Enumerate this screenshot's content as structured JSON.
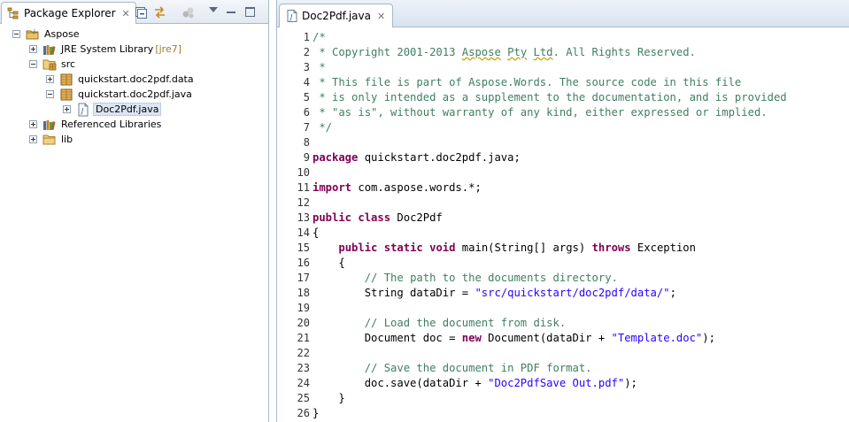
{
  "left_view": {
    "tab_label": "Package Explorer",
    "tree": [
      {
        "label": "Aspose",
        "decoration": "",
        "icon": "project-icon",
        "indent": 0,
        "expanded": true
      },
      {
        "label": "JRE System Library",
        "decoration": "[jre7]",
        "icon": "library-icon",
        "indent": 1,
        "expanded": false
      },
      {
        "label": "src",
        "decoration": "",
        "icon": "source-folder-icon",
        "indent": 1,
        "expanded": true
      },
      {
        "label": "quickstart.doc2pdf.data",
        "decoration": "",
        "icon": "package-icon",
        "indent": 2,
        "expanded": false
      },
      {
        "label": "quickstart.doc2pdf.java",
        "decoration": "",
        "icon": "package-icon",
        "indent": 2,
        "expanded": true
      },
      {
        "label": "Doc2Pdf.java",
        "decoration": "",
        "icon": "java-file-icon",
        "indent": 3,
        "expanded": false,
        "selected": true
      },
      {
        "label": "Referenced Libraries",
        "decoration": "",
        "icon": "library-icon",
        "indent": 1,
        "expanded": false
      },
      {
        "label": "lib",
        "decoration": "",
        "icon": "folder-icon",
        "indent": 1,
        "expanded": false
      }
    ]
  },
  "editor": {
    "tab_label": "Doc2Pdf.java",
    "lines": [
      {
        "n": "1",
        "parts": [
          {
            "t": "/*",
            "c": "cm"
          }
        ]
      },
      {
        "n": "2",
        "parts": [
          {
            "t": " * Copyright 2001-2013 ",
            "c": "cm"
          },
          {
            "t": "Aspose",
            "c": "cm sq"
          },
          {
            "t": " ",
            "c": "cm"
          },
          {
            "t": "Pty",
            "c": "cm sq"
          },
          {
            "t": " ",
            "c": "cm"
          },
          {
            "t": "Ltd",
            "c": "cm sq"
          },
          {
            "t": ". All Rights Reserved.",
            "c": "cm"
          }
        ]
      },
      {
        "n": "3",
        "parts": [
          {
            "t": " *",
            "c": "cm"
          }
        ]
      },
      {
        "n": "4",
        "parts": [
          {
            "t": " * This file is part of Aspose.Words. The source code in this file",
            "c": "cm"
          }
        ]
      },
      {
        "n": "5",
        "parts": [
          {
            "t": " * is only intended as a supplement to the documentation, and is provided",
            "c": "cm"
          }
        ]
      },
      {
        "n": "6",
        "parts": [
          {
            "t": " * \"as is\", without warranty of any kind, either expressed or implied.",
            "c": "cm"
          }
        ]
      },
      {
        "n": "7",
        "parts": [
          {
            "t": " */",
            "c": "cm"
          }
        ]
      },
      {
        "n": "8",
        "parts": []
      },
      {
        "n": "9",
        "parts": [
          {
            "t": "package",
            "c": "kw"
          },
          {
            "t": " quickstart.doc2pdf.java;",
            "c": "pl"
          }
        ]
      },
      {
        "n": "10",
        "parts": []
      },
      {
        "n": "11",
        "parts": [
          {
            "t": "import",
            "c": "kw"
          },
          {
            "t": " com.aspose.words.*;",
            "c": "pl"
          }
        ]
      },
      {
        "n": "12",
        "parts": []
      },
      {
        "n": "13",
        "parts": [
          {
            "t": "public",
            "c": "kw"
          },
          {
            "t": " ",
            "c": "pl"
          },
          {
            "t": "class",
            "c": "kw"
          },
          {
            "t": " Doc2Pdf",
            "c": "pl"
          }
        ]
      },
      {
        "n": "14",
        "parts": [
          {
            "t": "{",
            "c": "pl"
          }
        ]
      },
      {
        "n": "15",
        "parts": [
          {
            "t": "    ",
            "c": "pl"
          },
          {
            "t": "public",
            "c": "kw"
          },
          {
            "t": " ",
            "c": "pl"
          },
          {
            "t": "static",
            "c": "kw"
          },
          {
            "t": " ",
            "c": "pl"
          },
          {
            "t": "void",
            "c": "kw"
          },
          {
            "t": " main(String[] args) ",
            "c": "pl"
          },
          {
            "t": "throws",
            "c": "kw"
          },
          {
            "t": " Exception",
            "c": "pl"
          }
        ]
      },
      {
        "n": "16",
        "parts": [
          {
            "t": "    {",
            "c": "pl"
          }
        ]
      },
      {
        "n": "17",
        "parts": [
          {
            "t": "        ",
            "c": "pl"
          },
          {
            "t": "// The path to the documents directory.",
            "c": "cm"
          }
        ]
      },
      {
        "n": "18",
        "parts": [
          {
            "t": "        String dataDir = ",
            "c": "pl"
          },
          {
            "t": "\"src/quickstart/doc2pdf/data/\"",
            "c": "str"
          },
          {
            "t": ";",
            "c": "pl"
          }
        ]
      },
      {
        "n": "19",
        "parts": []
      },
      {
        "n": "20",
        "parts": [
          {
            "t": "        ",
            "c": "pl"
          },
          {
            "t": "// Load the document from disk.",
            "c": "cm"
          }
        ]
      },
      {
        "n": "21",
        "parts": [
          {
            "t": "        Document doc = ",
            "c": "pl"
          },
          {
            "t": "new",
            "c": "kw"
          },
          {
            "t": " Document(dataDir + ",
            "c": "pl"
          },
          {
            "t": "\"Template.doc\"",
            "c": "str"
          },
          {
            "t": ");",
            "c": "pl"
          }
        ]
      },
      {
        "n": "22",
        "parts": []
      },
      {
        "n": "23",
        "parts": [
          {
            "t": "        ",
            "c": "pl"
          },
          {
            "t": "// Save the document in PDF format.",
            "c": "cm"
          }
        ]
      },
      {
        "n": "24",
        "parts": [
          {
            "t": "        doc.save(dataDir + ",
            "c": "pl"
          },
          {
            "t": "\"Doc2PdfSave Out.pdf\"",
            "c": "str"
          },
          {
            "t": ");",
            "c": "pl"
          }
        ]
      },
      {
        "n": "25",
        "parts": [
          {
            "t": "    }",
            "c": "pl"
          }
        ]
      },
      {
        "n": "26",
        "parts": [
          {
            "t": "}",
            "c": "pl"
          }
        ]
      }
    ]
  },
  "colors": {
    "comment": "#3f7f5f",
    "keyword": "#7f0055",
    "string": "#2a00ff",
    "border": "#a9b8c9"
  }
}
